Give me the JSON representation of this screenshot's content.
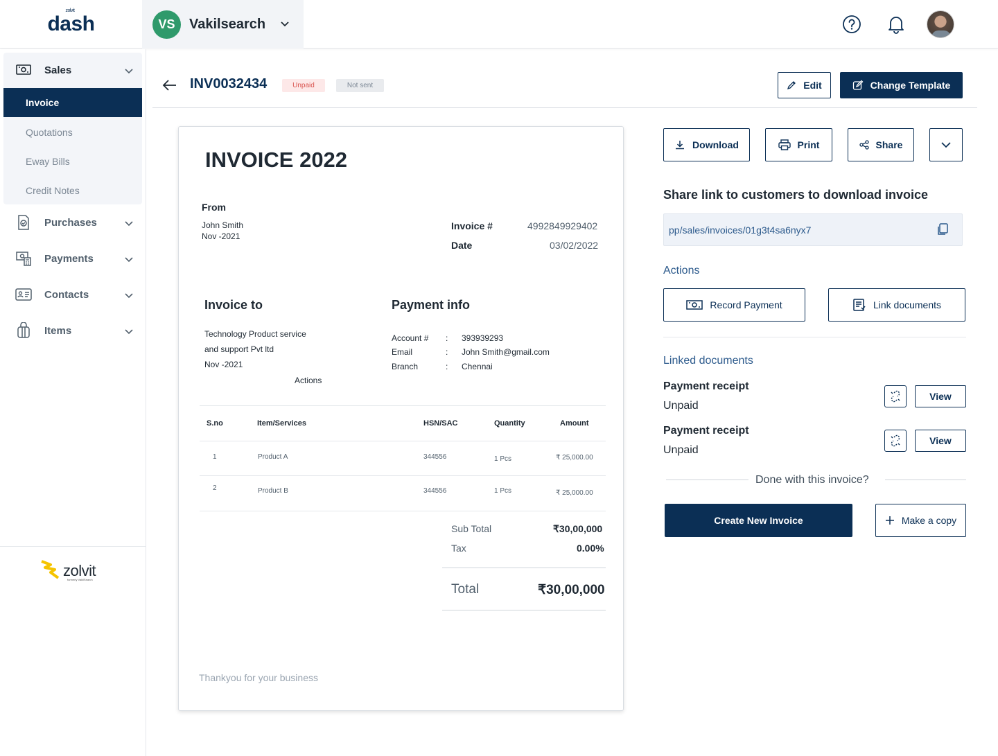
{
  "app": {
    "brand": "dash",
    "brand_sup": "zolvit"
  },
  "company": {
    "initials": "VS",
    "name": "Vakilsearch"
  },
  "sidebar": {
    "sales_label": "Sales",
    "sub_items": [
      "Invoice",
      "Quotations",
      "Eway Bills",
      "Credit Notes"
    ],
    "items": [
      {
        "label": "Purchases",
        "icon": "purchase-icon"
      },
      {
        "label": "Payments",
        "icon": "payments-icon"
      },
      {
        "label": "Contacts",
        "icon": "contacts-icon"
      },
      {
        "label": "Items",
        "icon": "items-icon"
      }
    ],
    "footer_logo": "zolvit",
    "footer_tagline": "formerly VakilSearch"
  },
  "header": {
    "invoice_number": "INV0032434",
    "badges": [
      "Unpaid",
      "Not sent"
    ],
    "edit_label": "Edit",
    "change_template_label": "Change Template"
  },
  "invoice": {
    "title": "INVOICE 2022",
    "from_label": "From",
    "from_name": "John Smith",
    "from_date": "Nov -2021",
    "invoice_no_label": "Invoice #",
    "invoice_no_value": "4992849929402",
    "date_label": "Date",
    "date_value": "03/02/2022",
    "invoice_to_label": "Invoice to",
    "invoice_to_lines": [
      "Technology Product service",
      "and support Pvt ltd",
      "Nov -2021"
    ],
    "invoice_to_actions": "Actions",
    "payment_info_label": "Payment info",
    "payment_info": [
      {
        "key": "Account #",
        "value": "393939293"
      },
      {
        "key": "Email",
        "value": "John Smith@gmail.com"
      },
      {
        "key": "Branch",
        "value": "Chennai"
      }
    ],
    "table": {
      "headers": [
        "S.no",
        "Item/Services",
        "HSN/SAC",
        "Quantity",
        "Amount"
      ],
      "rows": [
        [
          "1",
          "Product A",
          "344556",
          "1 Pcs",
          "₹ 25,000.00"
        ],
        [
          "2",
          "Product B",
          "344556",
          "1 Pcs",
          "₹ 25,000.00"
        ]
      ]
    },
    "subtotal_label": "Sub Total",
    "subtotal_value": "₹30,00,000",
    "tax_label": "Tax",
    "tax_value": "0.00%",
    "total_label": "Total",
    "total_value": "₹30,00,000",
    "footer_note": "Thankyou for your business"
  },
  "panel": {
    "download_label": "Download",
    "print_label": "Print",
    "share_label": "Share",
    "share_heading": "Share link to customers to download invoice",
    "share_link": "pp/sales/invoices/01g3t4sa6nyx7",
    "actions_heading": "Actions",
    "record_payment_label": "Record Payment",
    "link_documents_label": "Link documents",
    "linked_heading": "Linked documents",
    "linked_docs": [
      {
        "title": "Payment receipt",
        "status": "Unpaid",
        "view_label": "View"
      },
      {
        "title": "Payment receipt",
        "status": "Unpaid",
        "view_label": "View"
      }
    ],
    "done_text": "Done with this invoice?",
    "create_invoice_label": "Create New Invoice",
    "make_copy_label": "Make a copy"
  },
  "colors": {
    "primary": "#0b2f55",
    "accent_green": "#2f9a6b",
    "unpaid": "#d9534f"
  }
}
